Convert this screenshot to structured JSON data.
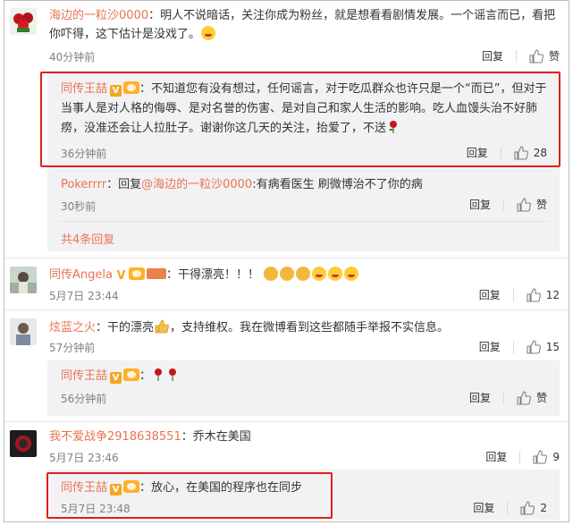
{
  "labels": {
    "reply": "回复",
    "praise": "赞"
  },
  "comments": [
    {
      "user": "海边的一粒沙0000",
      "text": "：明人不说暗话，关注你成为粉丝，就是想看看剧情发展。一个谣言而已，看把你吓得，这下估计是没戏了。",
      "time": "40分钟前",
      "likes": ""
    },
    {
      "user": "同传王喆",
      "text": "：不知道您有没有想过，任何谣言，对于吃瓜群众也许只是一个“而已”，但对于当事人是对人格的侮辱、是对名誉的伤害、是对自己和家人生活的影响。吃人血馒头治不好肺痨，没准还会让人拉肚子。谢谢你这几天的关注，抬爱了，不送",
      "time": "36分钟前",
      "likes": "28"
    },
    {
      "user": "Pokerrrr",
      "text_pre": "：回复",
      "mention": "@海边的一粒沙0000",
      "text": ":有病看医生 刷微博治不了你的病",
      "time": "30秒前",
      "likes": ""
    },
    {
      "more": "共4条回复"
    },
    {
      "user": "同传Angela",
      "text": "：干得漂亮！！！",
      "time": "5月7日 23:44",
      "likes": "12"
    },
    {
      "user": "炫蓝之火",
      "text_pre": "：干的漂亮",
      "text": "，支持维权。我在微博看到这些都随手举报不实信息。",
      "time": "57分钟前",
      "likes": "15"
    },
    {
      "user": "同传王喆",
      "text": "：",
      "time": "56分钟前",
      "likes": ""
    },
    {
      "user": "我不爱战争2918638551",
      "text": "：乔木在美国",
      "time": "5月7日 23:46",
      "likes": "9"
    },
    {
      "user": "同传王喆",
      "text": "：放心，在美国的程序也在同步",
      "time": "5月7日 23:48",
      "likes": "2"
    }
  ],
  "colors": {
    "name": "#eb7350",
    "highlight_box": "#e0201b",
    "reply_bg": "#f2f2f5"
  }
}
